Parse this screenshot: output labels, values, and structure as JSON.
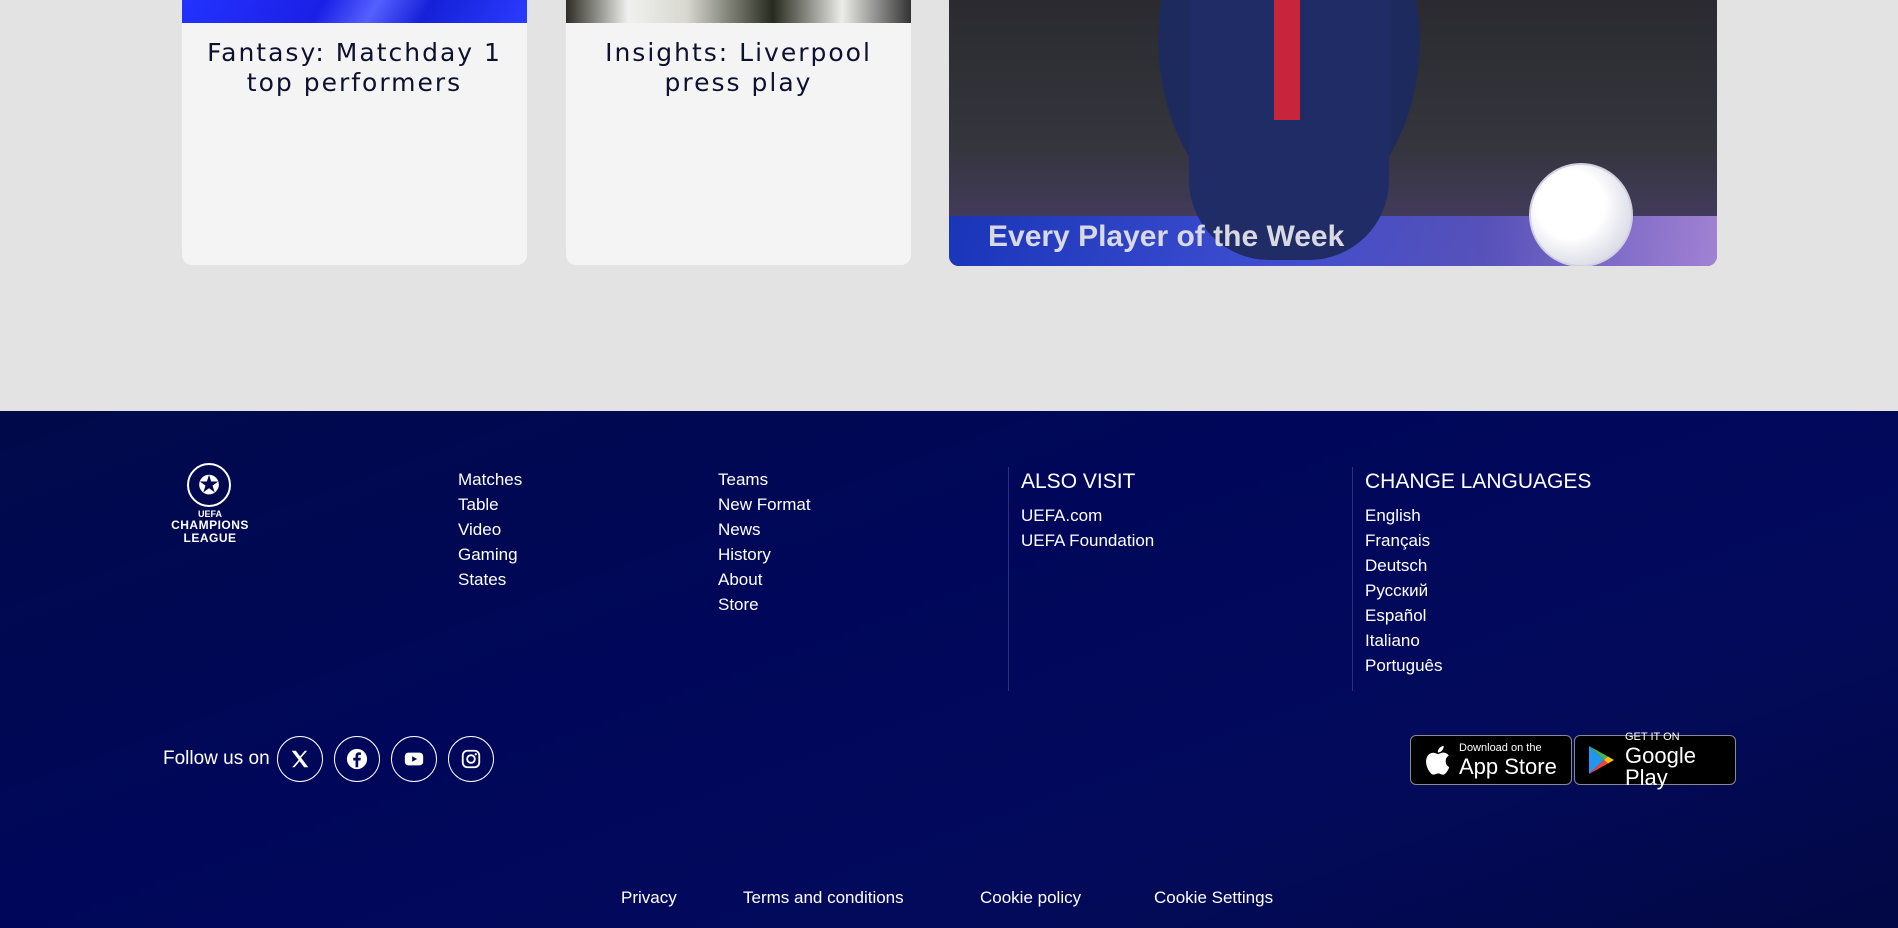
{
  "cards": [
    {
      "title": "Fantasy: Matchday 1 top performers"
    },
    {
      "title": "Insights: Liverpool press play"
    }
  ],
  "feature": {
    "title": "Every Player of the Week"
  },
  "footer": {
    "logo": {
      "line1": "UEFA",
      "line2": "CHAMPIONS",
      "line3": "LEAGUE"
    },
    "nav_col_1": [
      "Matches",
      "Table",
      "Video",
      "Gaming",
      "States"
    ],
    "nav_col_2": [
      "Teams",
      "New Format",
      "News",
      "History",
      "About",
      "Store"
    ],
    "also_visit": {
      "heading": "ALSO VISIT",
      "links": [
        "UEFA.com",
        "UEFA Foundation"
      ]
    },
    "change_languages": {
      "heading": "CHANGE LANGUAGES",
      "links": [
        "English",
        "Français",
        "Deutsch",
        "Русский",
        "Español",
        "Italiano",
        "Português"
      ]
    },
    "follow": {
      "label": "Follow us on",
      "icons": [
        "x-icon",
        "facebook-icon",
        "youtube-icon",
        "instagram-icon"
      ]
    },
    "stores": {
      "apple": {
        "small": "Download on the",
        "big": "App Store"
      },
      "google": {
        "small": "GET IT ON",
        "big": "Google Play"
      }
    },
    "legal": [
      "Privacy",
      "Terms and conditions",
      "Cookie policy",
      "Cookie Settings"
    ]
  },
  "colors": {
    "footer_bg": "#03095a",
    "page_bg": "#e3e3e3",
    "card_bg": "#f4f4f4"
  }
}
